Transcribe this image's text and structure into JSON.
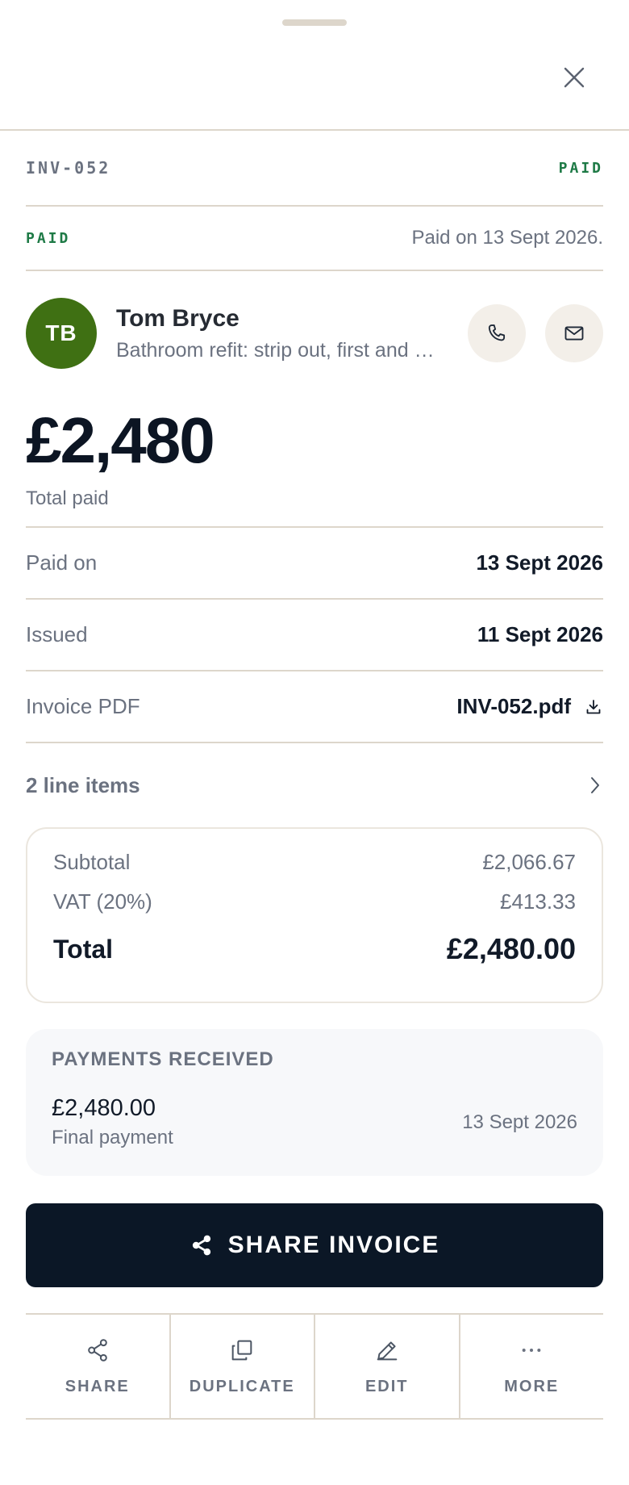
{
  "invoice": {
    "number": "INV-052",
    "badge": "PAID"
  },
  "status": {
    "tag": "PAID",
    "text": "Paid on 13 Sept 2026."
  },
  "client": {
    "initials": "TB",
    "name": "Tom Bryce",
    "description": "Bathroom refit: strip out, first and second fix plumbing",
    "avatar_color": "#3f7013"
  },
  "amount": {
    "value": "£2,480",
    "label": "Total paid"
  },
  "details": [
    {
      "label": "Paid on",
      "value": "13 Sept 2026"
    },
    {
      "label": "Issued",
      "value": "11 Sept 2026"
    },
    {
      "label": "Invoice PDF",
      "value": "INV-052.pdf"
    }
  ],
  "line_items": {
    "label": "2 line items"
  },
  "totals": {
    "subtotal_label": "Subtotal",
    "subtotal": "£2,066.67",
    "vat_label": "VAT (20%)",
    "vat": "£413.33",
    "total_label": "Total",
    "total": "£2,480.00"
  },
  "payments": {
    "title": "PAYMENTS RECEIVED",
    "items": [
      {
        "amount": "£2,480.00",
        "description": "Final payment",
        "date": "13 Sept 2026"
      }
    ]
  },
  "primary_action": {
    "label": "SHARE INVOICE"
  },
  "actions": [
    {
      "label": "SHARE",
      "icon": "share-icon"
    },
    {
      "label": "DUPLICATE",
      "icon": "duplicate-icon"
    },
    {
      "label": "EDIT",
      "icon": "pencil-icon"
    },
    {
      "label": "MORE",
      "icon": "more-icon"
    }
  ],
  "colors": {
    "accent_green": "#1e7a46",
    "primary_dark": "#0b1726",
    "divider": "#ddd6cb"
  }
}
